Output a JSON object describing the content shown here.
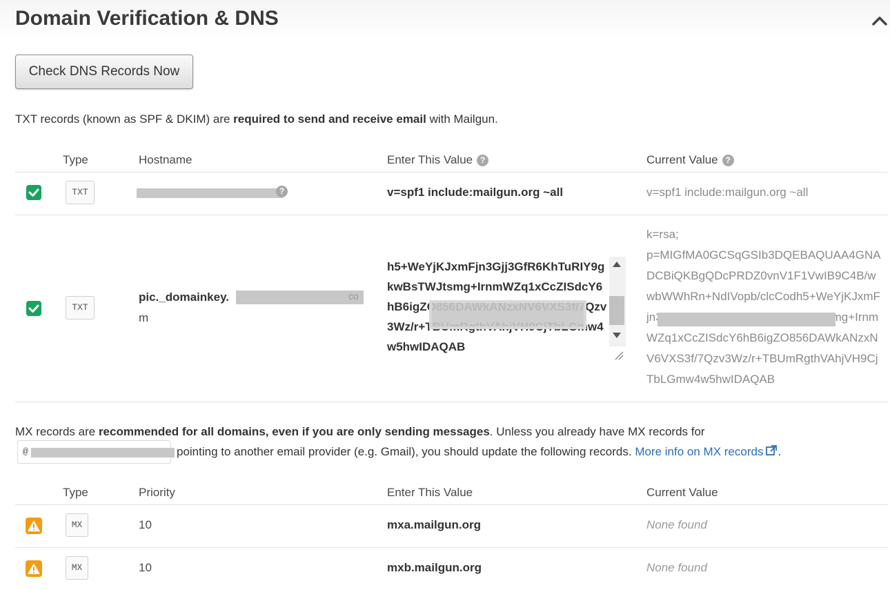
{
  "header": {
    "title": "Domain Verification & DNS",
    "collapse_icon": "chevron-up-icon"
  },
  "actions": {
    "check_dns_label": "Check DNS Records Now"
  },
  "txt_section": {
    "intro_prefix": "TXT records (known as SPF & DKIM) are ",
    "intro_bold": "required to send and receive email",
    "intro_suffix": " with Mailgun.",
    "columns": {
      "type": "Type",
      "hostname": "Hostname",
      "enter_value": "Enter This Value",
      "current_value": "Current Value"
    },
    "records": [
      {
        "status": "verified",
        "type": "TXT",
        "hostname": "",
        "enter_value": "v=spf1 include:mailgun.org ~all",
        "current_value": "v=spf1 include:mailgun.org ~all"
      },
      {
        "status": "verified",
        "type": "TXT",
        "hostname_prefix": "pic._domainkey.",
        "hostname_tail": "co",
        "hostname_wrap": "m",
        "enter_value": "h5+WeYjKJxmFjn3Gjj3GfR6KhTuRIY9gkwBsTWJtsmg+IrnmWZq1xCcZISdcY6hB6igZO856DAWkANzxNV6VXS3f/7Qzv3Wz/r+TBUmRgthVAhjVH9CjTbLGmw4w5hwIDAQAB",
        "current_value_line1": "k=rsa;",
        "current_value_rest": "p=MIGfMA0GCSqGSIb3DQEBAQUAA4GNADCBiQKBgQDcPRDZ0vnV1F1VwIB9C4B/wwbWWhRn+NdIVopb/clcCodh5+WeYjKJxmFjn3Gjj3GfR6KhTuRIY9gkwBsTWJtsmg+IrnmWZq1xCcZISdcY6hB6igZO856DAWkANzxNV6VXS3f/7Qzv3Wz/r+TBUmRgthVAhjVH9CjTbLGmw4w5hwIDAQAB"
      }
    ]
  },
  "mx_section": {
    "intro_prefix": "MX records are ",
    "intro_bold": "recommended for all domains, even if you are only sending messages",
    "intro_suffix": ". Unless you already have MX records for",
    "domain_prefix": "@",
    "line2_text": " pointing to another email provider (e.g. Gmail), you should update the following records. ",
    "link_text": "More info on MX records",
    "line2_end": ".",
    "columns": {
      "type": "Type",
      "priority": "Priority",
      "enter_value": "Enter This Value",
      "current_value": "Current Value"
    },
    "records": [
      {
        "status": "warning",
        "type": "MX",
        "priority": "10",
        "enter_value": "mxa.mailgun.org",
        "current_value": "None found"
      },
      {
        "status": "warning",
        "type": "MX",
        "priority": "10",
        "enter_value": "mxb.mailgun.org",
        "current_value": "None found"
      }
    ]
  },
  "colors": {
    "verified": "#1aa35e",
    "warning": "#f39c12",
    "link": "#2a6ebb",
    "muted_text": "#8a8a8a"
  }
}
